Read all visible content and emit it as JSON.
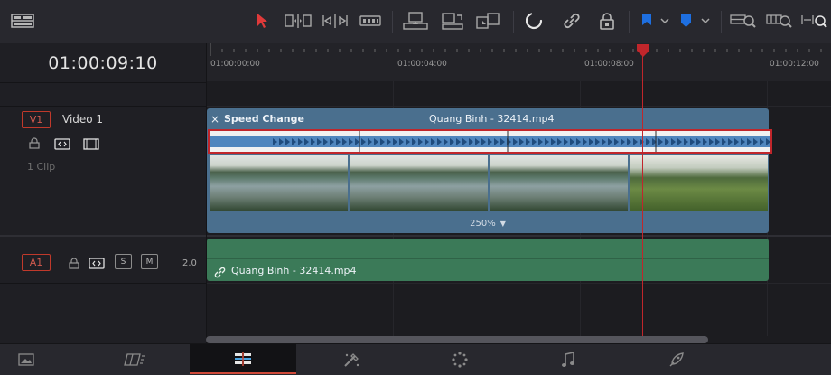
{
  "timecode": "01:00:09:10",
  "ruler": {
    "ticks": [
      "01:00:00:00",
      "01:00:04:00",
      "01:00:08:00",
      "01:00:12:00"
    ]
  },
  "video_track": {
    "badge": "V1",
    "name": "Video 1",
    "clip_count": "1 Clip",
    "clip": {
      "effect_label": "Speed Change",
      "close_glyph": "×",
      "title": "Quang Binh - 32414.mp4",
      "speed": "250%",
      "speed_caret": "▼"
    }
  },
  "audio_track": {
    "badge": "A1",
    "solo_label": "S",
    "mute_label": "M",
    "channels": "2.0",
    "clip": {
      "title": "Quang Binh - 32414.mp4"
    }
  },
  "toolbar": {
    "icons": [
      "layout-icon",
      "selection-arrow-icon",
      "trim-edit-icon",
      "dynamic-trim-icon",
      "blade-icon",
      "insert-clip-icon",
      "overwrite-clip-icon",
      "replace-clip-icon",
      "snapping-icon",
      "link-icon",
      "lock-icon",
      "flag-icon",
      "marker-icon",
      "zoom-full-icon",
      "zoom-detail-icon",
      "zoom-custom-icon"
    ],
    "flag_color": "#1e6fe0",
    "marker_color": "#1e6fe0",
    "selection_color": "#e03a3a"
  },
  "bottom_pages": [
    "media-page-icon",
    "cut-page-icon",
    "edit-page-icon",
    "fusion-page-icon",
    "color-page-icon",
    "fairlight-page-icon",
    "deliver-page-icon"
  ],
  "colors": {
    "video_clip": "#4a6f8e",
    "audio_clip": "#3b7a58",
    "playhead": "#c0262b",
    "accent": "#d04a3a"
  }
}
